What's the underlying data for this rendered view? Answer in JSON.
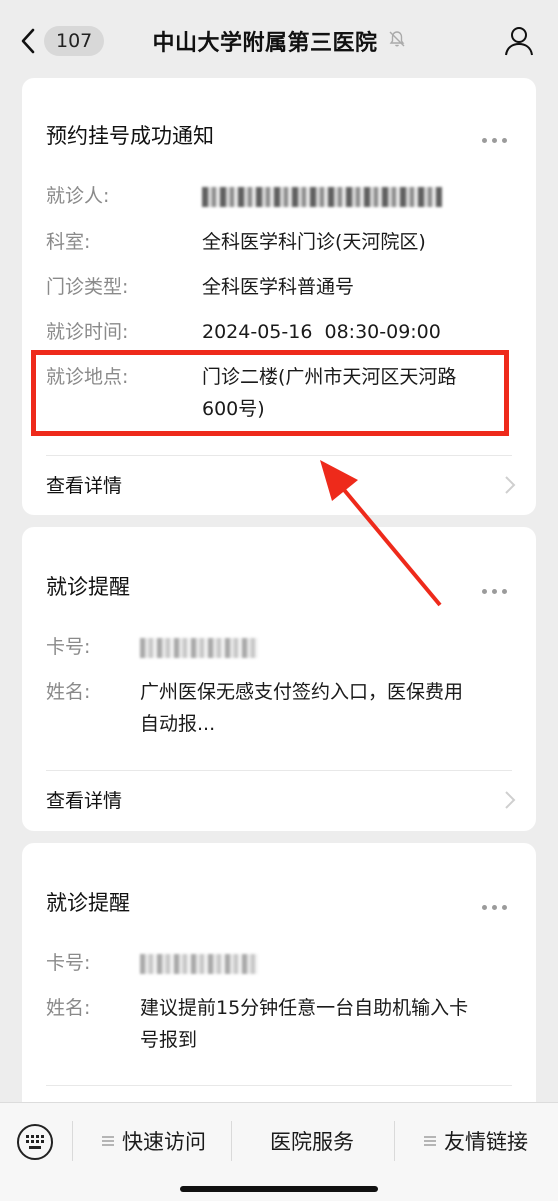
{
  "header": {
    "back_count": "107",
    "title": "中山大学附属第三医院"
  },
  "cards": [
    {
      "title": "预约挂号成功通知",
      "rows": [
        {
          "label": "就诊人:",
          "value": ""
        },
        {
          "label": "科室:",
          "value": "全科医学科门诊(天河院区)"
        },
        {
          "label": "门诊类型:",
          "value": "全科医学科普通号"
        },
        {
          "label": "就诊时间:",
          "value": "2024-05-16  08:30-09:00"
        },
        {
          "label": "就诊地点:",
          "value_line1": "门诊二楼(广州市天河区天河路",
          "value_line2": "600号)"
        }
      ],
      "link": "查看详情"
    },
    {
      "title": "就诊提醒",
      "rows": [
        {
          "label": "卡号:",
          "value": ""
        },
        {
          "label": "姓名:",
          "value_line1": "广州医保无感支付签约入口，医保费用",
          "value_line2": "自动报..."
        }
      ],
      "link": "查看详情"
    },
    {
      "title": "就诊提醒",
      "rows": [
        {
          "label": "卡号:",
          "value": ""
        },
        {
          "label": "姓名:",
          "value_line1": "建议提前15分钟任意一台自助机输入卡",
          "value_line2": "号报到"
        }
      ]
    }
  ],
  "bottom_menu": {
    "items": [
      "快速访问",
      "医院服务",
      "友情链接"
    ]
  },
  "colors": {
    "highlight": "#ee2a1b",
    "background": "#ededed"
  }
}
